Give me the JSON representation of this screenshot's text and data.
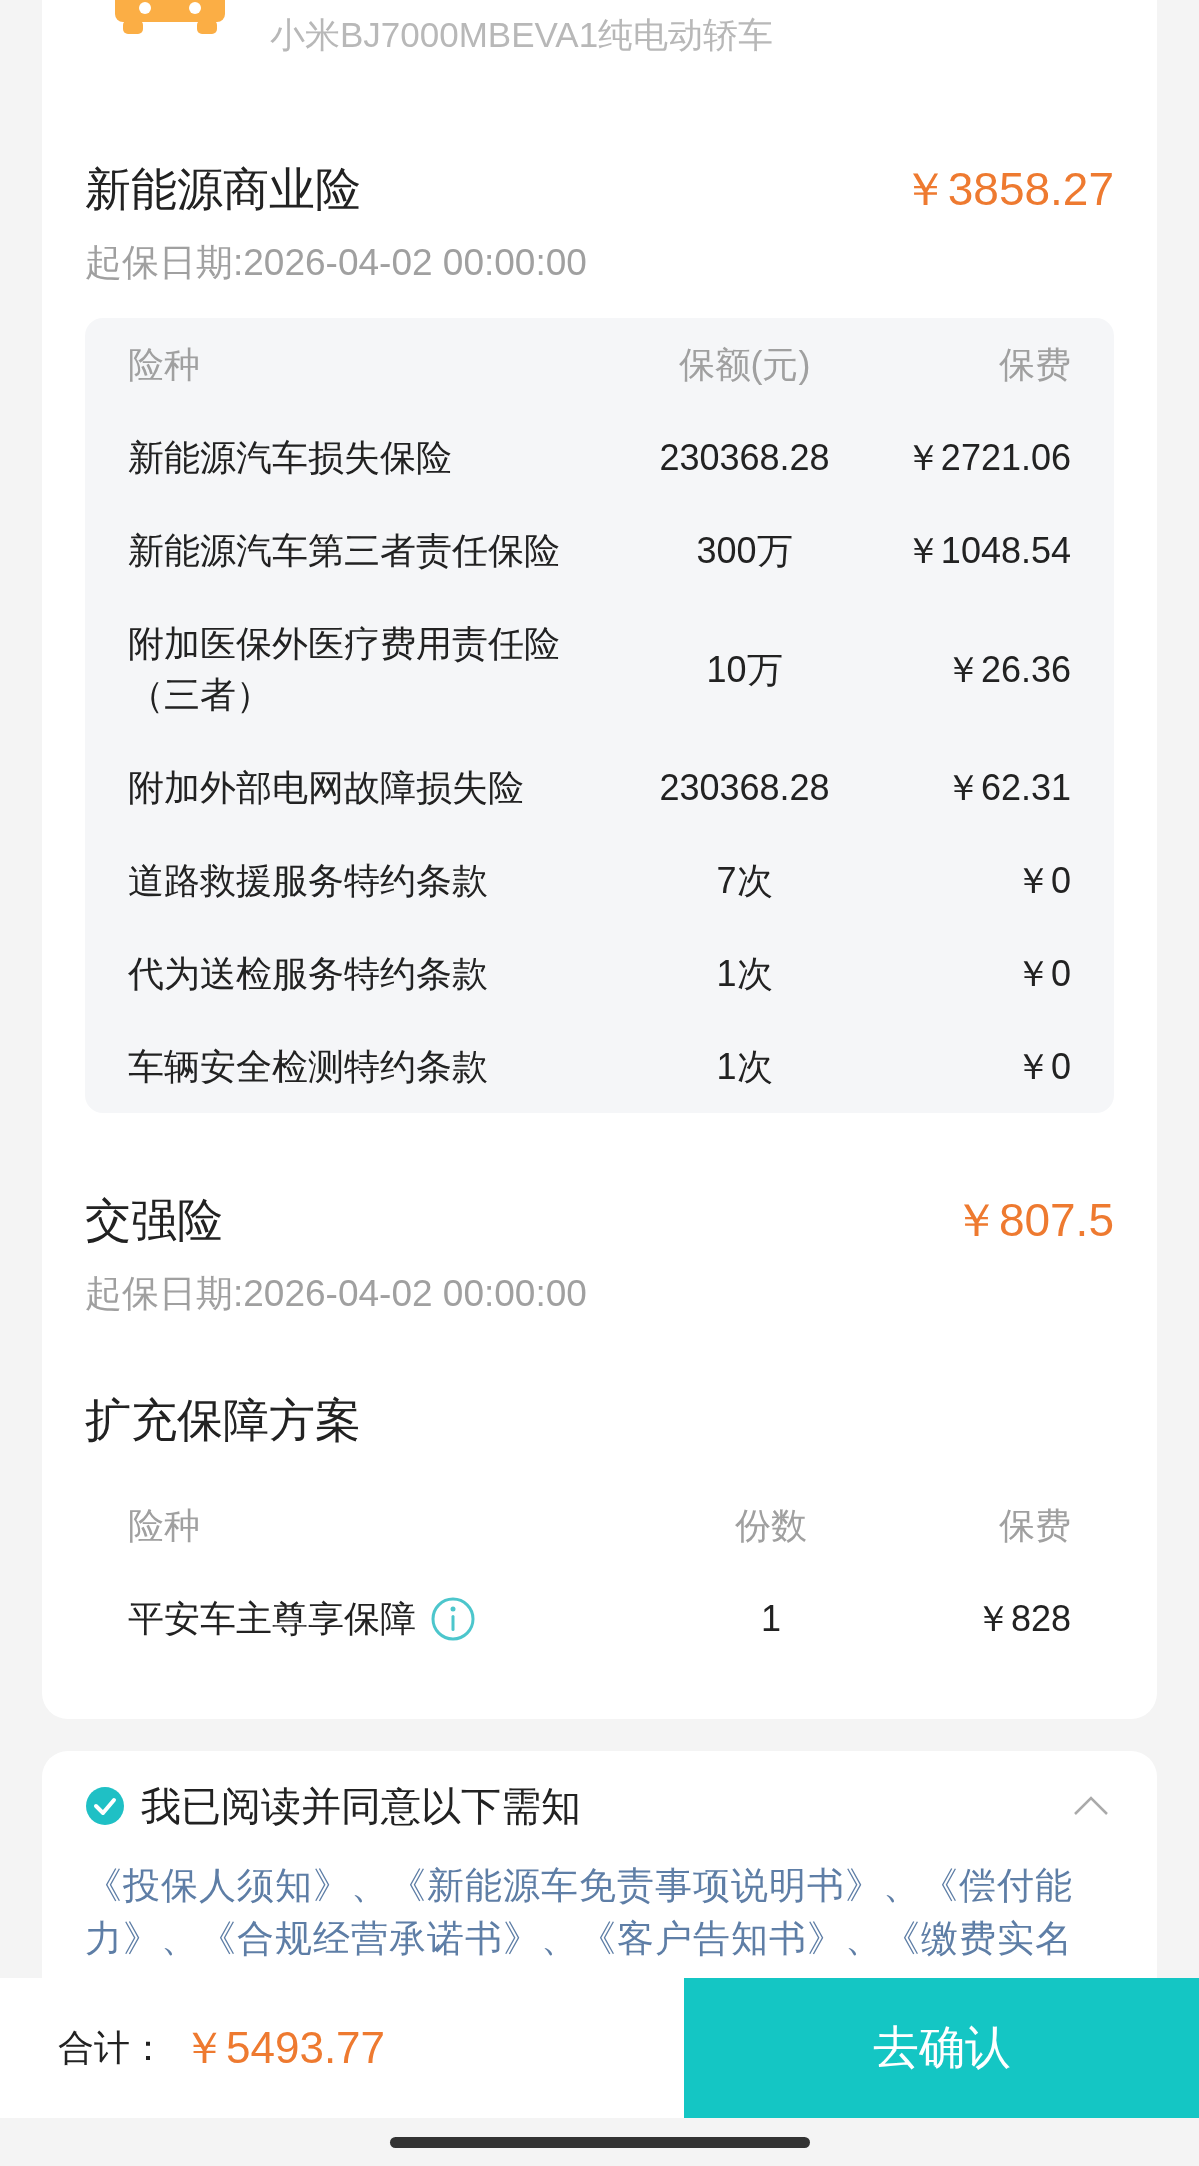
{
  "vehicle": {
    "model": "小米BJ7000MBEVA1纯电动轿车"
  },
  "policies": [
    {
      "title": "新能源商业险",
      "price": "￥3858.27",
      "start_date": "起保日期:2026-04-02 00:00:00",
      "table": {
        "columns": [
          "险种",
          "保额(元)",
          "保费"
        ],
        "rows": [
          {
            "name": "新能源汽车损失保险",
            "amount": "230368.28",
            "premium": "￥2721.06"
          },
          {
            "name": "新能源汽车第三者责任保险",
            "amount": "300万",
            "premium": "￥1048.54"
          },
          {
            "name": "附加医保外医疗费用责任险（三者）",
            "amount": "10万",
            "premium": "￥26.36"
          },
          {
            "name": "附加外部电网故障损失险",
            "amount": "230368.28",
            "premium": "￥62.31"
          },
          {
            "name": "道路救援服务特约条款",
            "amount": "7次",
            "premium": "￥0"
          },
          {
            "name": "代为送检服务特约条款",
            "amount": "1次",
            "premium": "￥0"
          },
          {
            "name": "车辆安全检测特约条款",
            "amount": "1次",
            "premium": "￥0"
          }
        ]
      }
    },
    {
      "title": "交强险",
      "price": "￥807.5",
      "start_date": "起保日期:2026-04-02 00:00:00"
    }
  ],
  "extension": {
    "title": "扩充保障方案",
    "columns": [
      "险种",
      "份数",
      "保费"
    ],
    "rows": [
      {
        "name": "平安车主尊享保障",
        "count": "1",
        "premium": "￥828",
        "info": true
      }
    ]
  },
  "agreement": {
    "checked": true,
    "label": "我已阅读并同意以下需知",
    "expanded": true,
    "text": "《投保人须知》、《新能源车免责事项说明书》、《偿付能力》、《合规经营承诺书》、《客户告知书》、《缴费实名"
  },
  "footer": {
    "total_label": "合计：",
    "total": "￥5493.77",
    "confirm": "去确认"
  }
}
